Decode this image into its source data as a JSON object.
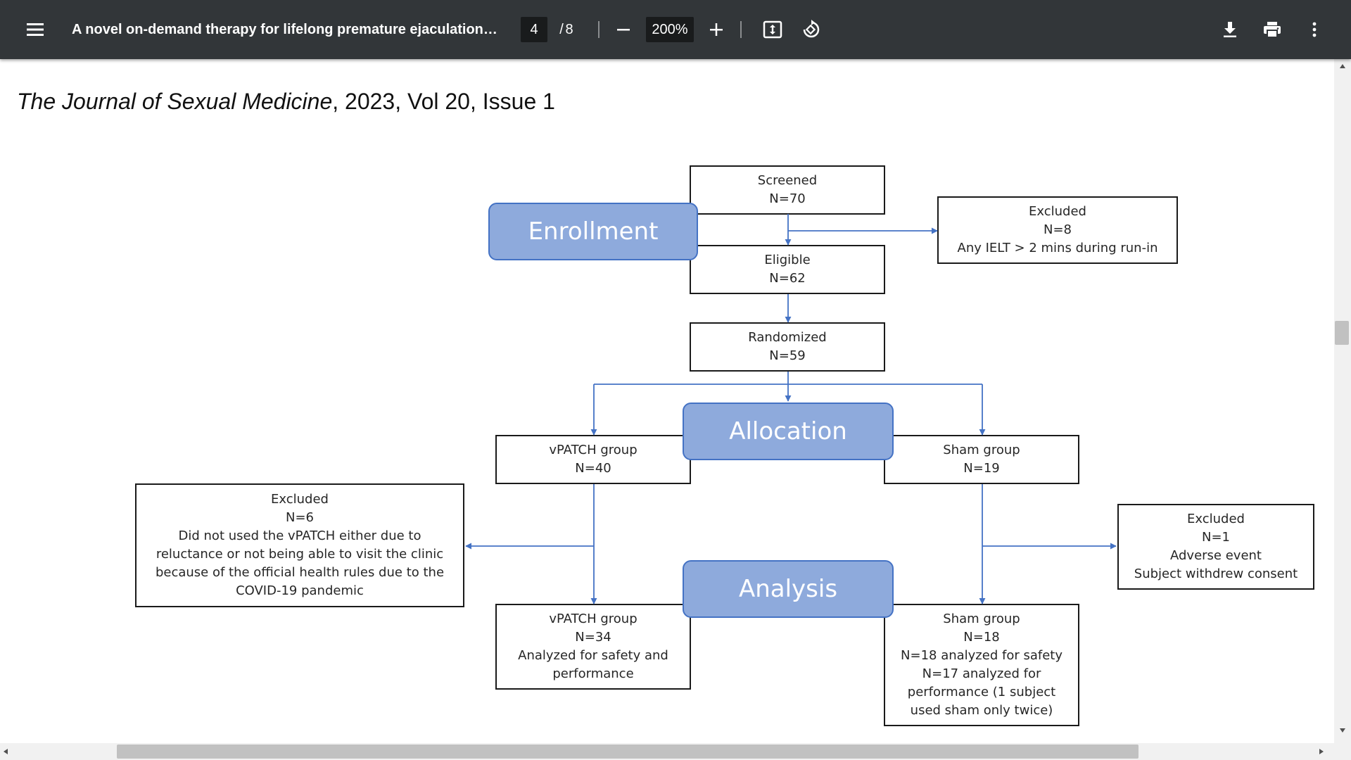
{
  "toolbar": {
    "title": "A novel on-demand therapy for lifelong premature ejaculation u...",
    "page_current": "4",
    "page_separator": "/",
    "page_total": "8",
    "zoom": "200%",
    "icons": [
      "menu-icon",
      "zoom-out-icon",
      "zoom-in-icon",
      "fit-page-icon",
      "rotate-icon",
      "download-icon",
      "print-icon",
      "more-vert-icon"
    ]
  },
  "page": {
    "journal_name": "The Journal of Sexual Medicine",
    "journal_details": ", 2023, Vol 20, Issue 1"
  },
  "diagram": {
    "phases": {
      "enrollment": "Enrollment",
      "allocation": "Allocation",
      "analysis": "Analysis"
    },
    "screened": {
      "label": "Screened",
      "n": "N=70"
    },
    "eligible": {
      "label": "Eligible",
      "n": "N=62"
    },
    "excluded_enrollment": {
      "label": "Excluded",
      "n": "N=8",
      "reason": "Any IELT > 2 mins during run-in"
    },
    "randomized": {
      "label": "Randomized",
      "n": "N=59"
    },
    "vpatch_alloc": {
      "label": "vPATCH group",
      "n": "N=40"
    },
    "sham_alloc": {
      "label": "Sham group",
      "n": "N=19"
    },
    "excluded_vpatch": {
      "label": "Excluded",
      "n": "N=6",
      "lines": [
        "Did not used the vPATCH either due to",
        "reluctance or not being able to visit the clinic",
        "because of the official health rules due to the",
        "COVID-19 pandemic"
      ]
    },
    "excluded_sham": {
      "label": "Excluded",
      "n": "N=1",
      "lines": [
        "Adverse event",
        "Subject withdrew consent"
      ]
    },
    "vpatch_analysis": {
      "label": "vPATCH group",
      "n": "N=34",
      "lines": [
        "Analyzed for safety and",
        "performance"
      ]
    },
    "sham_analysis": {
      "label": "Sham group",
      "lines": [
        "N=18",
        "N=18 analyzed for safety",
        "N=17 analyzed for",
        "performance (1 subject",
        "used sham only twice)"
      ]
    }
  },
  "colors": {
    "toolbar_bg": "#323639",
    "phase_fill": "#8eaadc",
    "phase_border": "#4472c4",
    "arrow": "#4472c4"
  }
}
